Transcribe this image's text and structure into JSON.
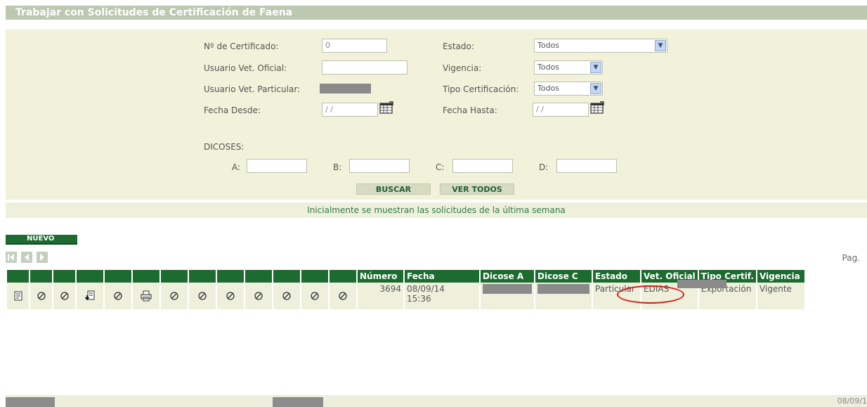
{
  "page": {
    "title": "Trabajar con Solicitudes de Certificación de Faena",
    "note": "Inicialmente se muestran las solicitudes de la última semana"
  },
  "filters": {
    "certificado_label": "Nº de Certificado:",
    "certificado_value": "0",
    "usuario_oficial_label": "Usuario Vet. Oficial:",
    "usuario_oficial_value": "",
    "usuario_particular_label": "Usuario Vet. Particular:",
    "fecha_desde_label": "Fecha Desde:",
    "fecha_desde_value": "/ /",
    "estado_label": "Estado:",
    "estado_value": "Todos",
    "vigencia_label": "Vigencia:",
    "vigencia_value": "Todos",
    "tipo_label": "Tipo Certificación:",
    "tipo_value": "Todos",
    "fecha_hasta_label": "Fecha Hasta:",
    "fecha_hasta_value": "/ /",
    "dicoses_label": "DICOSES:",
    "a_label": "A:",
    "b_label": "B:",
    "c_label": "C:",
    "d_label": "D:"
  },
  "buttons": {
    "buscar": "BUSCAR",
    "ver_todos": "VER TODOS",
    "nuevo": "NUEVO"
  },
  "pager": {
    "label": "Pag."
  },
  "table": {
    "headers": [
      "Número",
      "Fecha",
      "Dicose A",
      "Dicose C",
      "Estado",
      "Vet. Oficial",
      "Tipo Certif.",
      "Vigencia"
    ],
    "row": {
      "numero": "3694",
      "fecha_1": "08/09/14",
      "fecha_2": "15:36",
      "estado": "Particular",
      "vet_oficial": "EDIAS",
      "tipo": "Exportación",
      "vigencia": "Vigente"
    }
  },
  "footer": {
    "date": "08/09/1"
  },
  "colors": {
    "accent_green": "#1e6b31",
    "panel": "#f2f1d9",
    "highlight_red": "#d81b1b"
  }
}
